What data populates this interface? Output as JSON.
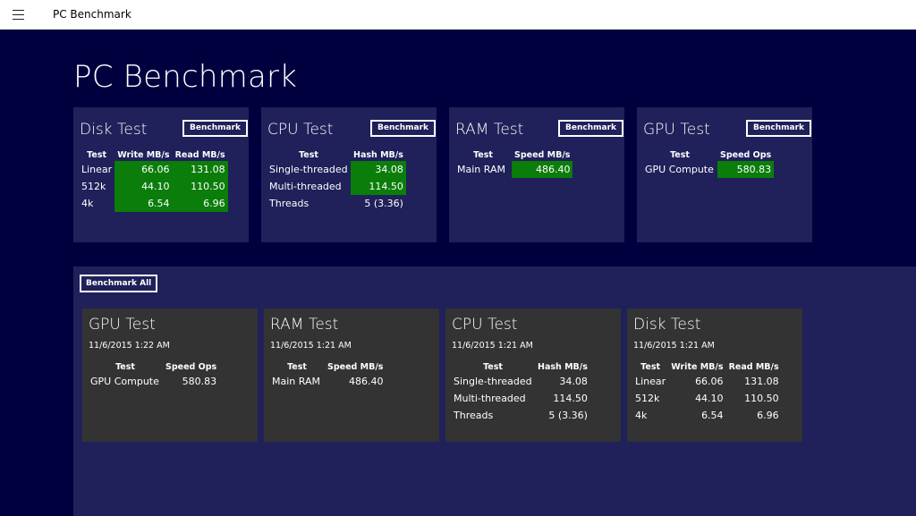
{
  "app": {
    "title": "PC Benchmark"
  },
  "page": {
    "title": "PC Benchmark"
  },
  "colors": {
    "background": "#00003f",
    "tile": "#20205a",
    "card": "#333333",
    "highlight": "#0a7d0a"
  },
  "tiles": {
    "disk": {
      "title": "Disk Test",
      "button": "Benchmark",
      "headers": [
        "Test",
        "Write MB/s",
        "Read MB/s"
      ],
      "rows": [
        [
          "Linear",
          "66.06",
          "131.08"
        ],
        [
          "512k",
          "44.10",
          "110.50"
        ],
        [
          "4k",
          "6.54",
          "6.96"
        ]
      ]
    },
    "cpu": {
      "title": "CPU Test",
      "button": "Benchmark",
      "headers": [
        "Test",
        "Hash MB/s"
      ],
      "rows": [
        [
          "Single-threaded",
          "34.08"
        ],
        [
          "Multi-threaded",
          "114.50"
        ],
        [
          "Threads",
          "5 (3.36)"
        ]
      ]
    },
    "ram": {
      "title": "RAM Test",
      "button": "Benchmark",
      "headers": [
        "Test",
        "Speed MB/s"
      ],
      "rows": [
        [
          "Main RAM",
          "486.40"
        ]
      ]
    },
    "gpu": {
      "title": "GPU Test",
      "button": "Benchmark",
      "headers": [
        "Test",
        "Speed Ops"
      ],
      "rows": [
        [
          "GPU Compute",
          "580.83"
        ]
      ]
    }
  },
  "history": {
    "button": "Benchmark All",
    "cards": {
      "gpu": {
        "title": "GPU Test",
        "date": "11/6/2015 1:22 AM",
        "headers": [
          "Test",
          "Speed Ops"
        ],
        "rows": [
          [
            "GPU Compute",
            "580.83"
          ]
        ]
      },
      "ram": {
        "title": "RAM Test",
        "date": "11/6/2015 1:21 AM",
        "headers": [
          "Test",
          "Speed MB/s"
        ],
        "rows": [
          [
            "Main RAM",
            "486.40"
          ]
        ]
      },
      "cpu": {
        "title": "CPU Test",
        "date": "11/6/2015 1:21 AM",
        "headers": [
          "Test",
          "Hash MB/s"
        ],
        "rows": [
          [
            "Single-threaded",
            "34.08"
          ],
          [
            "Multi-threaded",
            "114.50"
          ],
          [
            "Threads",
            "5 (3.36)"
          ]
        ]
      },
      "disk": {
        "title": "Disk Test",
        "date": "11/6/2015 1:21 AM",
        "headers": [
          "Test",
          "Write MB/s",
          "Read MB/s"
        ],
        "rows": [
          [
            "Linear",
            "66.06",
            "131.08"
          ],
          [
            "512k",
            "44.10",
            "110.50"
          ],
          [
            "4k",
            "6.54",
            "6.96"
          ]
        ]
      }
    }
  }
}
